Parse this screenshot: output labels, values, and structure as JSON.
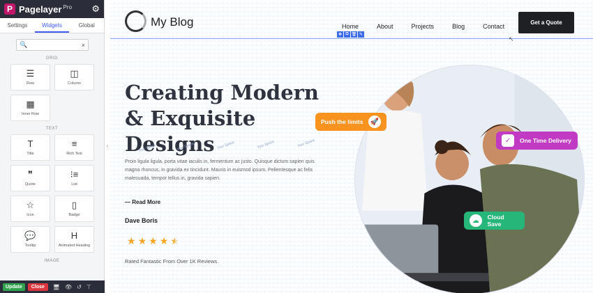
{
  "sidebar": {
    "brand": "Pagelayer",
    "brand_pro": "Pro",
    "tabs": [
      "Settings",
      "Widgets",
      "Global"
    ],
    "search_placeholder": "",
    "sections": [
      {
        "title": "GRID",
        "items": [
          {
            "label": "Row",
            "icon": "row-icon",
            "glyph": "☰"
          },
          {
            "label": "Column",
            "icon": "column-icon",
            "glyph": "◫"
          },
          {
            "label": "Inner Row",
            "icon": "inner-row-icon",
            "glyph": "▦"
          }
        ]
      },
      {
        "title": "TEXT",
        "items": [
          {
            "label": "Title",
            "icon": "title-icon",
            "glyph": "T"
          },
          {
            "label": "Rich Text",
            "icon": "rich-text-icon",
            "glyph": "≡"
          },
          {
            "label": "Quote",
            "icon": "quote-icon",
            "glyph": "❞"
          },
          {
            "label": "List",
            "icon": "list-icon",
            "glyph": "⁝≡"
          },
          {
            "label": "Icon",
            "icon": "star-outline-icon",
            "glyph": "☆"
          },
          {
            "label": "Badge",
            "icon": "badge-icon",
            "glyph": "▯"
          },
          {
            "label": "Tooltip",
            "icon": "tooltip-icon",
            "glyph": "💬"
          },
          {
            "label": "Animated Heading",
            "icon": "heading-icon",
            "glyph": "H"
          }
        ]
      },
      {
        "title": "IMAGE",
        "items": []
      }
    ],
    "update_label": "Update",
    "close_label": "Close"
  },
  "site": {
    "logo_text": "My Blog",
    "nav": [
      "Home",
      "About",
      "Projects",
      "Blog",
      "Contact"
    ],
    "quote_button": "Get a Quote",
    "hero_title": "Creating Modern & Exquisite Designs",
    "spacer_label": "Your Space",
    "paragraph": "Proin ligula ligula, porta vitae iaculis in, fermentum ac justo. Quisque dictum sapien quis magna rhoncus, in gravida ex tincidunt. Mauris in euismod ipsum. Pellentesque ac felis malesuada, tempor tellus in, gravida sapien.",
    "read_more": "Read More",
    "author": "Dave Boris",
    "rating": 4.5,
    "rated_text": "Rated Fantastic From Over 1K Reviews.",
    "badges": {
      "push": "Push the limits",
      "delivery": "One Time Delivery",
      "cloud": "Cloud Save"
    }
  },
  "colors": {
    "accent_orange": "#f7931e",
    "accent_purple": "#c13ac4",
    "accent_green": "#27b67a",
    "brand_pink": "#c2186b",
    "tab_active": "#3d5af1"
  }
}
